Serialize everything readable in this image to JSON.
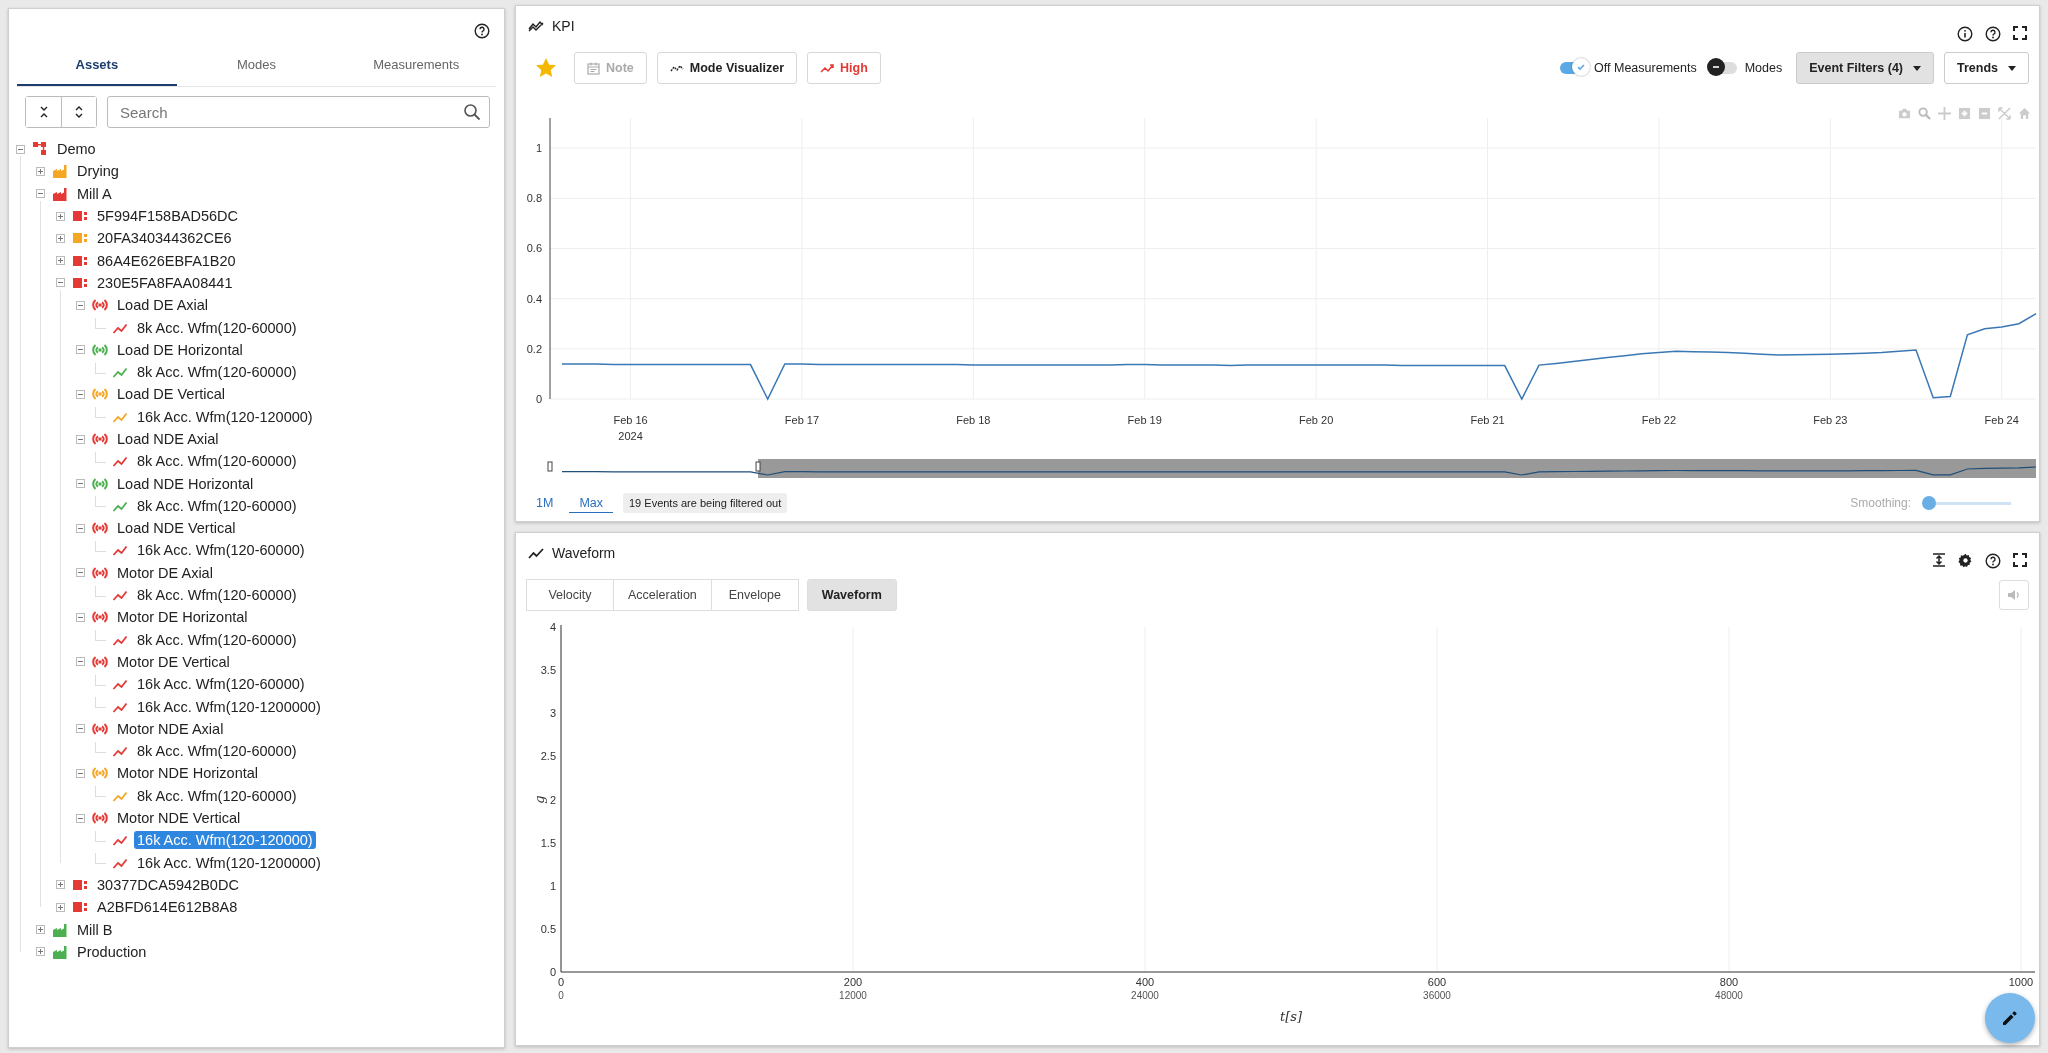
{
  "sidebar": {
    "tabs": [
      {
        "label": "Assets",
        "selected": true
      },
      {
        "label": "Modes",
        "selected": false
      },
      {
        "label": "Measurements",
        "selected": false
      }
    ],
    "search": {
      "placeholder": "Search"
    },
    "tree": [
      {
        "label": "Demo",
        "kind": "site",
        "color": "#e53935",
        "expanded": true,
        "selected": false,
        "children": [
          {
            "label": "Drying",
            "kind": "area",
            "color": "#f5a623",
            "expanded": false,
            "selected": false
          },
          {
            "label": "Mill A",
            "kind": "area",
            "color": "#e53935",
            "expanded": true,
            "selected": false,
            "children": [
              {
                "label": "5F994F158BAD56DC",
                "kind": "machine",
                "color": "#e53935",
                "expanded": false,
                "selected": false
              },
              {
                "label": "20FA340344362CE6",
                "kind": "machine",
                "color": "#f5a623",
                "expanded": false,
                "selected": false
              },
              {
                "label": "86A4E626EBFA1B20",
                "kind": "machine",
                "color": "#e53935",
                "expanded": false,
                "selected": false
              },
              {
                "label": "230E5FA8FAA08441",
                "kind": "machine",
                "color": "#e53935",
                "expanded": true,
                "selected": false,
                "children": [
                  {
                    "label": "Load DE Axial",
                    "kind": "point",
                    "color": "#e53935",
                    "expanded": true,
                    "selected": false,
                    "children": [
                      {
                        "label": "8k Acc. Wfm(120-60000)",
                        "kind": "measurement",
                        "color": "#e53935",
                        "selected": false
                      }
                    ]
                  },
                  {
                    "label": "Load DE Horizontal",
                    "kind": "point",
                    "color": "#4caf50",
                    "expanded": true,
                    "selected": false,
                    "children": [
                      {
                        "label": "8k Acc. Wfm(120-60000)",
                        "kind": "measurement",
                        "color": "#4caf50",
                        "selected": false
                      }
                    ]
                  },
                  {
                    "label": "Load DE Vertical",
                    "kind": "point",
                    "color": "#f5a623",
                    "expanded": true,
                    "selected": false,
                    "children": [
                      {
                        "label": "16k Acc. Wfm(120-120000)",
                        "kind": "measurement",
                        "color": "#f5a623",
                        "selected": false
                      }
                    ]
                  },
                  {
                    "label": "Load NDE Axial",
                    "kind": "point",
                    "color": "#e53935",
                    "expanded": true,
                    "selected": false,
                    "children": [
                      {
                        "label": "8k Acc. Wfm(120-60000)",
                        "kind": "measurement",
                        "color": "#e53935",
                        "selected": false
                      }
                    ]
                  },
                  {
                    "label": "Load NDE Horizontal",
                    "kind": "point",
                    "color": "#4caf50",
                    "expanded": true,
                    "selected": false,
                    "children": [
                      {
                        "label": "8k Acc. Wfm(120-60000)",
                        "kind": "measurement",
                        "color": "#4caf50",
                        "selected": false
                      }
                    ]
                  },
                  {
                    "label": "Load NDE Vertical",
                    "kind": "point",
                    "color": "#e53935",
                    "expanded": true,
                    "selected": false,
                    "children": [
                      {
                        "label": "16k Acc. Wfm(120-60000)",
                        "kind": "measurement",
                        "color": "#e53935",
                        "selected": false
                      }
                    ]
                  },
                  {
                    "label": "Motor DE Axial",
                    "kind": "point",
                    "color": "#e53935",
                    "expanded": true,
                    "selected": false,
                    "children": [
                      {
                        "label": "8k Acc. Wfm(120-60000)",
                        "kind": "measurement",
                        "color": "#e53935",
                        "selected": false
                      }
                    ]
                  },
                  {
                    "label": "Motor DE Horizontal",
                    "kind": "point",
                    "color": "#e53935",
                    "expanded": true,
                    "selected": false,
                    "children": [
                      {
                        "label": "8k Acc. Wfm(120-60000)",
                        "kind": "measurement",
                        "color": "#e53935",
                        "selected": false
                      }
                    ]
                  },
                  {
                    "label": "Motor DE Vertical",
                    "kind": "point",
                    "color": "#e53935",
                    "expanded": true,
                    "selected": false,
                    "children": [
                      {
                        "label": "16k Acc. Wfm(120-60000)",
                        "kind": "measurement",
                        "color": "#e53935",
                        "selected": false
                      },
                      {
                        "label": "16k Acc. Wfm(120-1200000)",
                        "kind": "measurement",
                        "color": "#e53935",
                        "selected": false
                      }
                    ]
                  },
                  {
                    "label": "Motor NDE Axial",
                    "kind": "point",
                    "color": "#e53935",
                    "expanded": true,
                    "selected": false,
                    "children": [
                      {
                        "label": "8k Acc. Wfm(120-60000)",
                        "kind": "measurement",
                        "color": "#e53935",
                        "selected": false
                      }
                    ]
                  },
                  {
                    "label": "Motor NDE Horizontal",
                    "kind": "point",
                    "color": "#f5a623",
                    "expanded": true,
                    "selected": false,
                    "children": [
                      {
                        "label": "8k Acc. Wfm(120-60000)",
                        "kind": "measurement",
                        "color": "#f5a623",
                        "selected": false
                      }
                    ]
                  },
                  {
                    "label": "Motor NDE Vertical",
                    "kind": "point",
                    "color": "#e53935",
                    "expanded": true,
                    "selected": false,
                    "children": [
                      {
                        "label": "16k Acc. Wfm(120-120000)",
                        "kind": "measurement",
                        "color": "#e53935",
                        "selected": true
                      },
                      {
                        "label": "16k Acc. Wfm(120-1200000)",
                        "kind": "measurement",
                        "color": "#e53935",
                        "selected": false
                      }
                    ]
                  }
                ]
              },
              {
                "label": "30377DCA5942B0DC",
                "kind": "machine",
                "color": "#e53935",
                "expanded": false,
                "selected": false
              },
              {
                "label": "A2BFD614E612B8A8",
                "kind": "machine",
                "color": "#e53935",
                "expanded": false,
                "selected": false
              }
            ]
          },
          {
            "label": "Mill B",
            "kind": "area",
            "color": "#4caf50",
            "expanded": false,
            "selected": false
          },
          {
            "label": "Production",
            "kind": "area",
            "color": "#4caf50",
            "expanded": false,
            "selected": false
          }
        ]
      }
    ]
  },
  "kpi_panel": {
    "title": "KPI",
    "favorite": {
      "on": true
    },
    "buttons": [
      {
        "label": "Note",
        "kind": "note",
        "disabled": true
      },
      {
        "label": "Mode Visualizer",
        "kind": "mode",
        "disabled": false
      },
      {
        "label": "High",
        "kind": "alert",
        "disabled": false
      }
    ],
    "toggles": [
      {
        "label": "Off Measurements",
        "on": true
      },
      {
        "label": "Modes",
        "on": false
      }
    ],
    "dropdowns": [
      {
        "label": "Event Filters (4)",
        "kind": "filled"
      },
      {
        "label": "Trends",
        "kind": "outline"
      }
    ],
    "chart_data": {
      "type": "line",
      "ylim": [
        0,
        1.12
      ],
      "yticks": [
        0,
        0.2,
        0.4,
        0.6,
        0.8,
        1
      ],
      "grid": true,
      "categories": [
        null,
        null,
        null,
        null,
        "Feb 16",
        null,
        null,
        null,
        null,
        null,
        null,
        null,
        null,
        null,
        "Feb 17",
        null,
        null,
        null,
        null,
        null,
        null,
        null,
        null,
        null,
        "Feb 18",
        null,
        null,
        null,
        null,
        null,
        null,
        null,
        null,
        null,
        "Feb 19",
        null,
        null,
        null,
        null,
        null,
        null,
        null,
        null,
        null,
        "Feb 20",
        null,
        null,
        null,
        null,
        null,
        null,
        null,
        null,
        null,
        "Feb 21",
        null,
        null,
        null,
        null,
        null,
        null,
        null,
        null,
        null,
        "Feb 22",
        null,
        null,
        null,
        null,
        null,
        null,
        null,
        null,
        null,
        "Feb 23",
        null,
        null,
        null,
        null,
        null,
        null,
        null,
        null,
        null,
        "Feb 24",
        null,
        null
      ],
      "annotations": [
        "2024"
      ],
      "series": [
        {
          "color": "#3a78b5",
          "values": [
            0.14,
            0.139,
            0.139,
            0.138,
            0.138,
            0.138,
            0.137,
            0.137,
            0.137,
            0.138,
            0.138,
            0.137,
            0,
            0.14,
            0.139,
            0.138,
            0.137,
            0.137,
            0.138,
            0.138,
            0.138,
            0.138,
            0.137,
            0.137,
            0.136,
            0.136,
            0.136,
            0.136,
            0.135,
            0.135,
            0.135,
            0.136,
            0.136,
            0.137,
            0.137,
            0.136,
            0.136,
            0.135,
            0.135,
            0.134,
            0.135,
            0.135,
            0.136,
            0.136,
            0.136,
            0.136,
            0.135,
            0.135,
            0.135,
            0.134,
            0.134,
            0.134,
            0.134,
            0.134,
            0.134,
            0.133,
            0,
            0.135,
            0.142,
            0.15,
            0.158,
            0.165,
            0.172,
            0.18,
            0.185,
            0.19,
            0.188,
            0.187,
            0.185,
            0.182,
            0.178,
            0.175,
            0.176,
            0.177,
            0.178,
            0.18,
            0.182,
            0.185,
            0.19,
            0.195,
            0.005,
            0.01,
            0.256,
            0.28,
            0.287,
            0.3,
            0.34
          ]
        }
      ]
    },
    "navigator": {
      "level": 0.86
    },
    "ranges": [
      {
        "label": "1M",
        "selected": false
      },
      {
        "label": "Max",
        "selected": true
      }
    ],
    "filter_notice": "19 Events are being filtered out",
    "smoothing": {
      "label": "Smoothing:",
      "level": 0
    }
  },
  "waveform_panel": {
    "title": "Waveform",
    "tabs": [
      {
        "label": "Velocity",
        "selected": false
      },
      {
        "label": "Acceleration",
        "selected": false
      },
      {
        "label": "Envelope",
        "selected": false
      },
      {
        "label": "Waveform",
        "selected": true
      }
    ],
    "sound_button": {
      "disabled": true
    },
    "chart_data": {
      "type": "line",
      "xlabel": "t[s]",
      "ylabel": "g",
      "xlim": [
        0,
        1000
      ],
      "ylim": [
        0,
        4
      ],
      "xticks": [
        0,
        200,
        400,
        600,
        800,
        1000
      ],
      "yticks": [
        0,
        0.5,
        1,
        1.5,
        2,
        2.5,
        3,
        3.5,
        4
      ],
      "grid": true
    },
    "secondary_axis_labels": [
      "0",
      "12000",
      "24000",
      "36000",
      "48000"
    ]
  }
}
